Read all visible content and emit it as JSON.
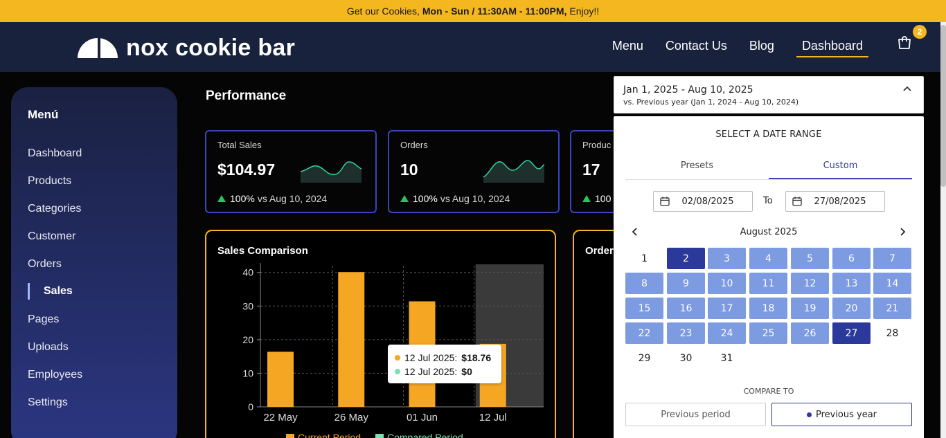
{
  "promo": {
    "prefix": "Get our Cookies,",
    "hours": "Mon - Sun / 11:30AM - 11:00PM,",
    "suffix": "Enjoy!!"
  },
  "brand": {
    "name": "nox cookie bar"
  },
  "nav": [
    {
      "label": "Menu"
    },
    {
      "label": "Contact Us"
    },
    {
      "label": "Blog"
    },
    {
      "label": "Dashboard",
      "active": true
    }
  ],
  "cart": {
    "count": "2"
  },
  "sidebar": {
    "title": "Menú",
    "items": [
      {
        "label": "Dashboard"
      },
      {
        "label": "Products"
      },
      {
        "label": "Categories"
      },
      {
        "label": "Customer"
      },
      {
        "label": "Orders"
      },
      {
        "label": "Sales",
        "active": true
      },
      {
        "label": "Pages"
      },
      {
        "label": "Uploads"
      },
      {
        "label": "Employees"
      },
      {
        "label": "Settings"
      }
    ]
  },
  "performance": {
    "title": "Performance",
    "kpis": [
      {
        "label": "Total Sales",
        "value": "$104.97",
        "delta_pct": "100%",
        "delta_text": "vs Aug 10, 2024"
      },
      {
        "label": "Orders",
        "value": "10",
        "delta_pct": "100%",
        "delta_text": "vs Aug 10, 2024"
      },
      {
        "label": "Produc",
        "value": "17",
        "delta_pct": "100",
        "delta_text": ""
      }
    ]
  },
  "sales_chart": {
    "title": "Sales Comparison",
    "legend_current": "Current Period",
    "legend_compared": "Compared Period",
    "tooltip": {
      "row1_date": "12 Jul 2025:",
      "row1_value": "$18.76",
      "row2_date": "12 Jul 2025:",
      "row2_value": "$0"
    }
  },
  "chart_data": {
    "type": "bar",
    "title": "Sales Comparison",
    "categories": [
      "22 May",
      "26 May",
      "01 Jun",
      "12 Jul"
    ],
    "series": [
      {
        "name": "Current Period",
        "values": [
          16.4,
          40.1,
          31.4,
          18.76
        ],
        "color": "#f5a623"
      },
      {
        "name": "Compared Period",
        "values": [
          0,
          0,
          0,
          0
        ],
        "color": "#7ee0b0"
      }
    ],
    "yticks": [
      0,
      10,
      20,
      30,
      40
    ],
    "ylim": [
      0,
      42
    ],
    "grid": true,
    "highlighted_category": "12 Jul"
  },
  "orders_card": {
    "title": "Orders"
  },
  "date_picker": {
    "range": "Jan 1, 2025 - Aug 10, 2025",
    "compare": "vs. Previous year (Jan 1, 2024 - Aug 10, 2024)",
    "popover_title": "SELECT A DATE RANGE",
    "tabs": [
      {
        "label": "Presets"
      },
      {
        "label": "Custom",
        "active": true
      }
    ],
    "start_date": "02/08/2025",
    "to_label": "To",
    "end_date": "27/08/2025",
    "month": "August 2025",
    "range_start_day": 2,
    "range_end_day": 27,
    "days": [
      "1",
      "2",
      "3",
      "4",
      "5",
      "6",
      "7",
      "8",
      "9",
      "10",
      "11",
      "12",
      "13",
      "14",
      "15",
      "16",
      "17",
      "18",
      "19",
      "20",
      "21",
      "22",
      "23",
      "24",
      "25",
      "26",
      "27",
      "28",
      "29",
      "30",
      "31"
    ],
    "compare_label": "COMPARE TO",
    "compare_options": [
      {
        "label": "Previous period"
      },
      {
        "label": "Previous year",
        "active": true
      }
    ]
  },
  "colors": {
    "accent": "#f5b720",
    "navy": "#18223d",
    "range": "#7d9be0",
    "range_edge": "#2b3a9a",
    "up": "#22c55e"
  }
}
